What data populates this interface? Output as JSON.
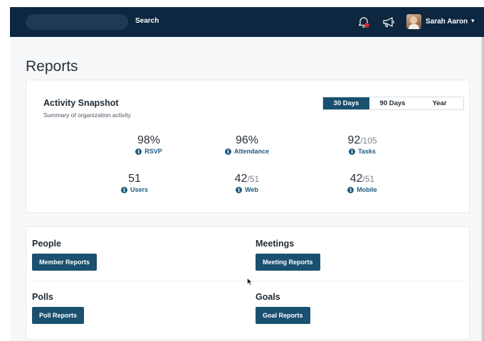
{
  "header": {
    "search_label": "Search",
    "user_name": "Sarah Aaron",
    "user_caret": "▾",
    "icons": [
      "bell-icon",
      "megaphone-icon"
    ],
    "notification_color": "#e0281e",
    "bar_color": "#0e2740"
  },
  "page": {
    "title": "Reports"
  },
  "snapshot": {
    "title": "Activity Snapshot",
    "subtitle": "Summary of organization activity",
    "ranges": [
      "30 Days",
      "90 Days",
      "Year"
    ],
    "selected_range": "30 Days",
    "info_glyph": "i",
    "stats": [
      {
        "value": "98%",
        "denominator": "",
        "label": "RSVP"
      },
      {
        "value": "96%",
        "denominator": "",
        "label": "Attendance"
      },
      {
        "value": "92",
        "denominator": "/105",
        "label": "Tasks"
      },
      {
        "value": "51",
        "denominator": "",
        "label": "Users"
      },
      {
        "value": "42",
        "denominator": "/51",
        "label": "Web"
      },
      {
        "value": "42",
        "denominator": "/51",
        "label": "Mobile"
      }
    ]
  },
  "sections": {
    "people": {
      "title": "People",
      "button": "Member Reports"
    },
    "meetings": {
      "title": "Meetings",
      "button": "Meeting Reports"
    },
    "polls": {
      "title": "Polls",
      "button": "Poll Reports"
    },
    "goals": {
      "title": "Goals",
      "button": "Goal Reports"
    }
  },
  "colors": {
    "accent": "#1a5070",
    "link": "#1e5a80"
  }
}
